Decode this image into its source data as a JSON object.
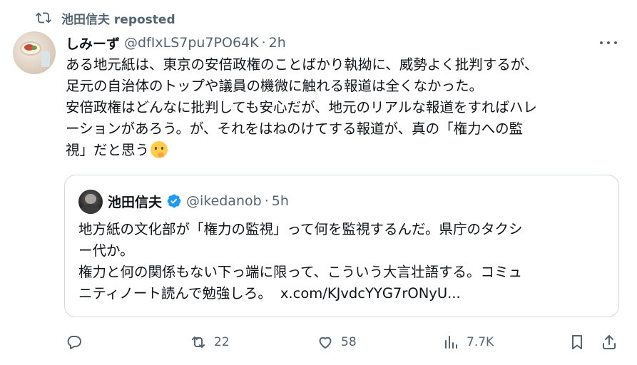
{
  "repost_banner": {
    "icon": "repost-icon",
    "text": "池田信夫 reposted"
  },
  "post": {
    "author_name": "しみーず",
    "handle": "@dfIxLS7pu7PO64K",
    "separator": "·",
    "time": "2h",
    "lines": [
      "ある地元紙は、東京の安倍政権のことばかり執拗に、威勢よく批判するが、",
      "足元の自治体のトップや議員の機微に触れる報道は全くなかった。",
      "安倍政権はどんなに批判しても安心だが、地元のリアルな報道をすればハレ",
      "ーションがあろう。が、それをはねのけてする報道が、真の「権力への監",
      "視」だと思う"
    ],
    "emoji": "thinking-face-emoji"
  },
  "quote": {
    "author_name": "池田信夫",
    "verified_icon": "verified-badge-icon",
    "handle": "@ikedanob",
    "separator": "·",
    "time": "5h",
    "lines": [
      "地方紙の文化部が「権力の監視」って何を監視するんだ。県庁のタクシ",
      "ー代か。",
      "権力と何の関係もない下っ端に限って、こういう大言壮語する。コミュ",
      "ニティノート読んで勉強しろ。"
    ],
    "link": "x.com/KJvdcYYG7rONyU..."
  },
  "actions": {
    "replies": "",
    "reposts": "22",
    "likes": "58",
    "views": "7.7K"
  },
  "colors": {
    "text": "#0f1419",
    "secondary": "#536471",
    "verified": "#1d9bf0",
    "border": "#cfd9de"
  }
}
